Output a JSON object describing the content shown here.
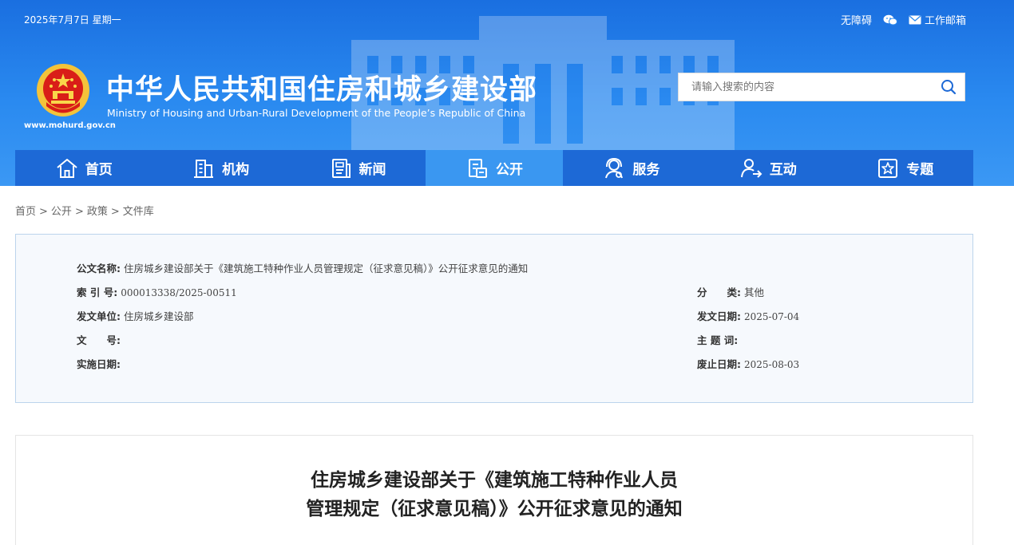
{
  "header": {
    "date": "2025年7月7日 星期一",
    "accessibility": "无障碍",
    "wechat_icon": "wechat-icon",
    "mail_icon": "mail-icon",
    "mail_label": "工作邮箱",
    "site_url": "www.mohurd.gov.cn",
    "title_cn": "中华人民共和国住房和城乡建设部",
    "title_en": "Ministry of Housing and Urban-Rural Development of the People’s Republic of China",
    "search_placeholder": "请输入搜索的内容",
    "colors": {
      "header_bg": "#2a8af0",
      "nav_bg": "#1d69d6",
      "nav_active": "#3a97f1"
    }
  },
  "nav": {
    "items": [
      {
        "label": "首页",
        "icon": "home-icon"
      },
      {
        "label": "机构",
        "icon": "building-icon"
      },
      {
        "label": "新闻",
        "icon": "news-icon"
      },
      {
        "label": "公开",
        "icon": "document-icon",
        "active": true
      },
      {
        "label": "服务",
        "icon": "service-icon"
      },
      {
        "label": "互动",
        "icon": "user-interact-icon"
      },
      {
        "label": "专题",
        "icon": "star-icon"
      }
    ]
  },
  "breadcrumb": [
    "首页",
    "公开",
    "政策",
    "文件库"
  ],
  "meta": {
    "doc_name_label": "公文名称:",
    "doc_name": "住房城乡建设部关于《建筑施工特种作业人员管理规定（征求意见稿）》公开征求意见的通知",
    "index_label": "索 引 号:",
    "index": "000013338/2025-00511",
    "category_label": "分　　类:",
    "category": "其他",
    "issuer_label": "发文单位:",
    "issuer": "住房城乡建设部",
    "issue_date_label": "发文日期:",
    "issue_date": "2025-07-04",
    "doc_no_label": "文　　号:",
    "doc_no": "",
    "subject_label": "主 题 词:",
    "subject": "",
    "effective_label": "实施日期:",
    "effective": "",
    "expiry_label": "废止日期:",
    "expiry": "2025-08-03"
  },
  "article": {
    "title_line1": "住房城乡建设部关于《建筑施工特种作业人员",
    "title_line2": "管理规定（征求意见稿）》公开征求意见的通知"
  }
}
